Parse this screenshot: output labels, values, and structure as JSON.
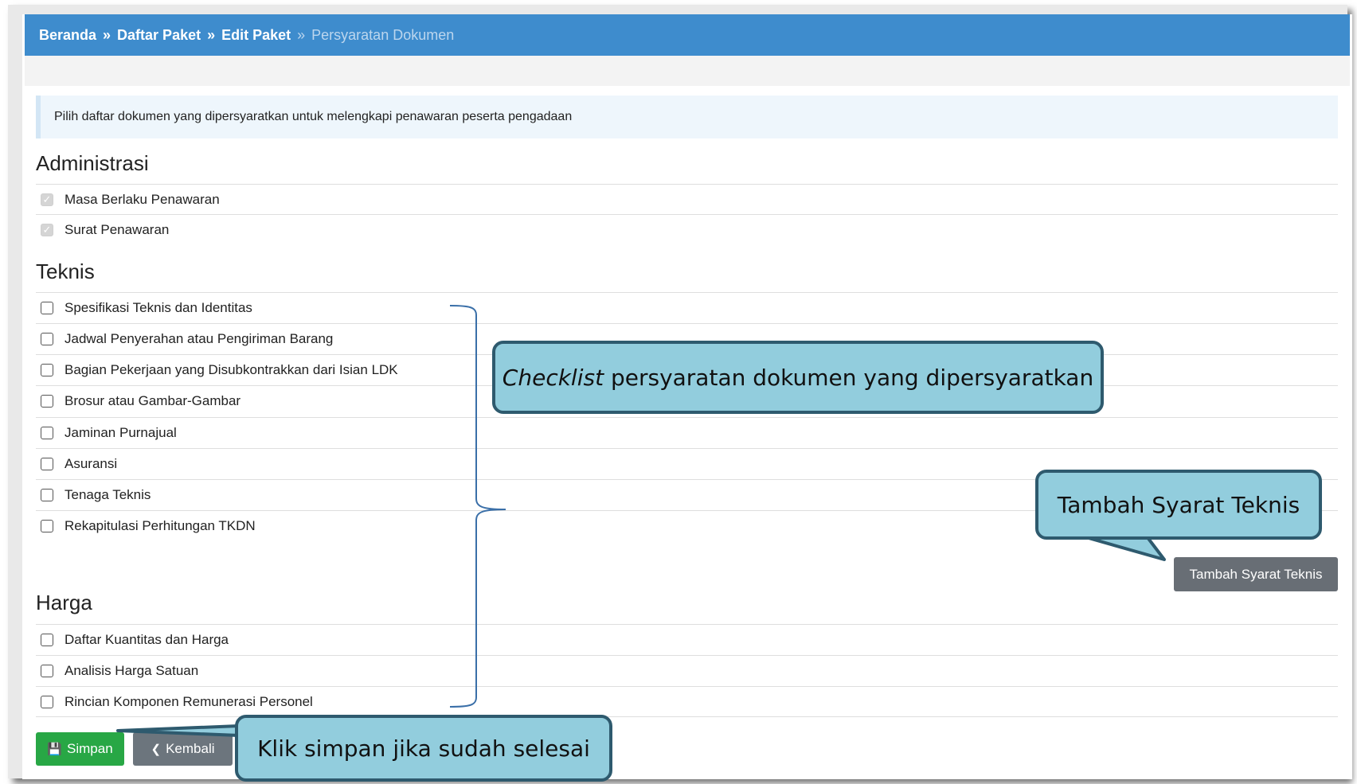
{
  "breadcrumb": {
    "items": [
      "Beranda",
      "Daftar Paket",
      "Edit Paket"
    ],
    "separator": "»",
    "active": "Persyaratan Dokumen"
  },
  "info_text": "Pilih daftar dokumen yang dipersyaratkan untuk melengkapi penawaran peserta pengadaan",
  "sections": {
    "administrasi": {
      "title": "Administrasi",
      "items": [
        {
          "label": "Masa Berlaku Penawaran",
          "checked": true,
          "disabled": true
        },
        {
          "label": "Surat Penawaran",
          "checked": true,
          "disabled": true
        }
      ]
    },
    "teknis": {
      "title": "Teknis",
      "items": [
        {
          "label": "Spesifikasi Teknis dan Identitas",
          "checked": false
        },
        {
          "label": "Jadwal Penyerahan atau Pengiriman Barang",
          "checked": false
        },
        {
          "label": "Bagian Pekerjaan yang Disubkontrakkan dari Isian LDK",
          "checked": false
        },
        {
          "label": "Brosur atau Gambar-Gambar",
          "checked": false
        },
        {
          "label": "Jaminan Purnajual",
          "checked": false
        },
        {
          "label": "Asuransi",
          "checked": false
        },
        {
          "label": "Tenaga Teknis",
          "checked": false
        },
        {
          "label": "Rekapitulasi Perhitungan TKDN",
          "checked": false
        }
      ]
    },
    "harga": {
      "title": "Harga",
      "items": [
        {
          "label": "Daftar Kuantitas dan Harga",
          "checked": false
        },
        {
          "label": "Analisis Harga Satuan",
          "checked": false
        },
        {
          "label": "Rincian Komponen Remunerasi Personel",
          "checked": false
        }
      ]
    }
  },
  "buttons": {
    "tambah_syarat_teknis": "Tambah Syarat Teknis",
    "simpan": "Simpan",
    "kembali": "Kembali"
  },
  "callouts": {
    "checklist_em": "Checklist",
    "checklist_rest": " persyaratan dokumen yang dipersyaratkan",
    "tambah": "Tambah Syarat Teknis",
    "simpan": "Klik simpan jika sudah selesai"
  },
  "colors": {
    "breadcrumb_bg": "#3e8ccd",
    "save_green": "#28a745",
    "back_grey": "#6c757d",
    "callout_fill": "#92cddd",
    "callout_border": "#2e5a6e"
  }
}
